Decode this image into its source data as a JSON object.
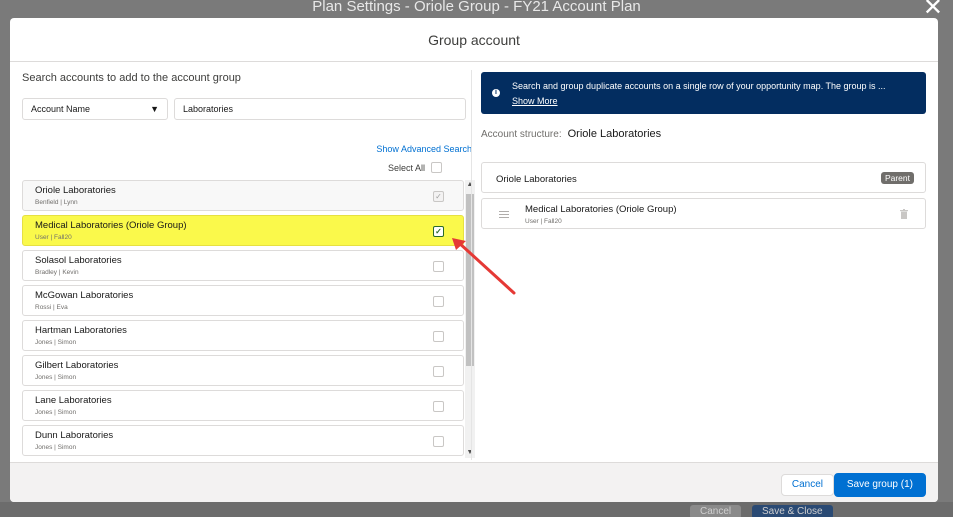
{
  "backdrop": {
    "title": "Plan Settings - Oriole Group - FY21 Account Plan",
    "close_glyph": "✕",
    "footer": {
      "cancel": "Cancel",
      "save": "Save & Close"
    }
  },
  "modal": {
    "title": "Group account"
  },
  "left": {
    "title": "Search accounts to add to the account group",
    "field_select": "Account Name",
    "search_value": "Laboratories",
    "advanced_search": "Show Advanced Search",
    "select_all": "Select All",
    "accounts": [
      {
        "name": "Oriole Laboratories",
        "sub": "Benfield | Lynn",
        "state": "checked-disabled",
        "mark": "✓"
      },
      {
        "name": "Medical Laboratories (Oriole Group)",
        "sub": "User | Fall20",
        "state": "checked",
        "mark": "✓"
      },
      {
        "name": "Solasol Laboratories",
        "sub": "Bradley | Kevin",
        "state": "unchecked",
        "mark": ""
      },
      {
        "name": "McGowan Laboratories",
        "sub": "Rossi | Eva",
        "state": "unchecked",
        "mark": ""
      },
      {
        "name": "Hartman Laboratories",
        "sub": "Jones | Simon",
        "state": "unchecked",
        "mark": ""
      },
      {
        "name": "Gilbert Laboratories",
        "sub": "Jones | Simon",
        "state": "unchecked",
        "mark": ""
      },
      {
        "name": "Lane Laboratories",
        "sub": "Jones | Simon",
        "state": "unchecked",
        "mark": ""
      },
      {
        "name": "Dunn Laboratories",
        "sub": "Jones | Simon",
        "state": "unchecked",
        "mark": ""
      }
    ]
  },
  "right": {
    "banner_message": "Search and group duplicate accounts on a single row of your opportunity map. The group is ...",
    "banner_link": "Show More",
    "structure_label": "Account structure:",
    "structure_name": "Oriole Laboratories",
    "parent_name": "Oriole Laboratories",
    "parent_badge": "Parent",
    "child_name": "Medical Laboratories (Oriole Group)",
    "child_sub": "User | Fall20"
  },
  "footer": {
    "cancel": "Cancel",
    "save": "Save group (1)"
  },
  "colors": {
    "brand": "#0070d2",
    "banner": "#032d60",
    "highlight": "#faf94b",
    "arrow": "#e53935"
  }
}
